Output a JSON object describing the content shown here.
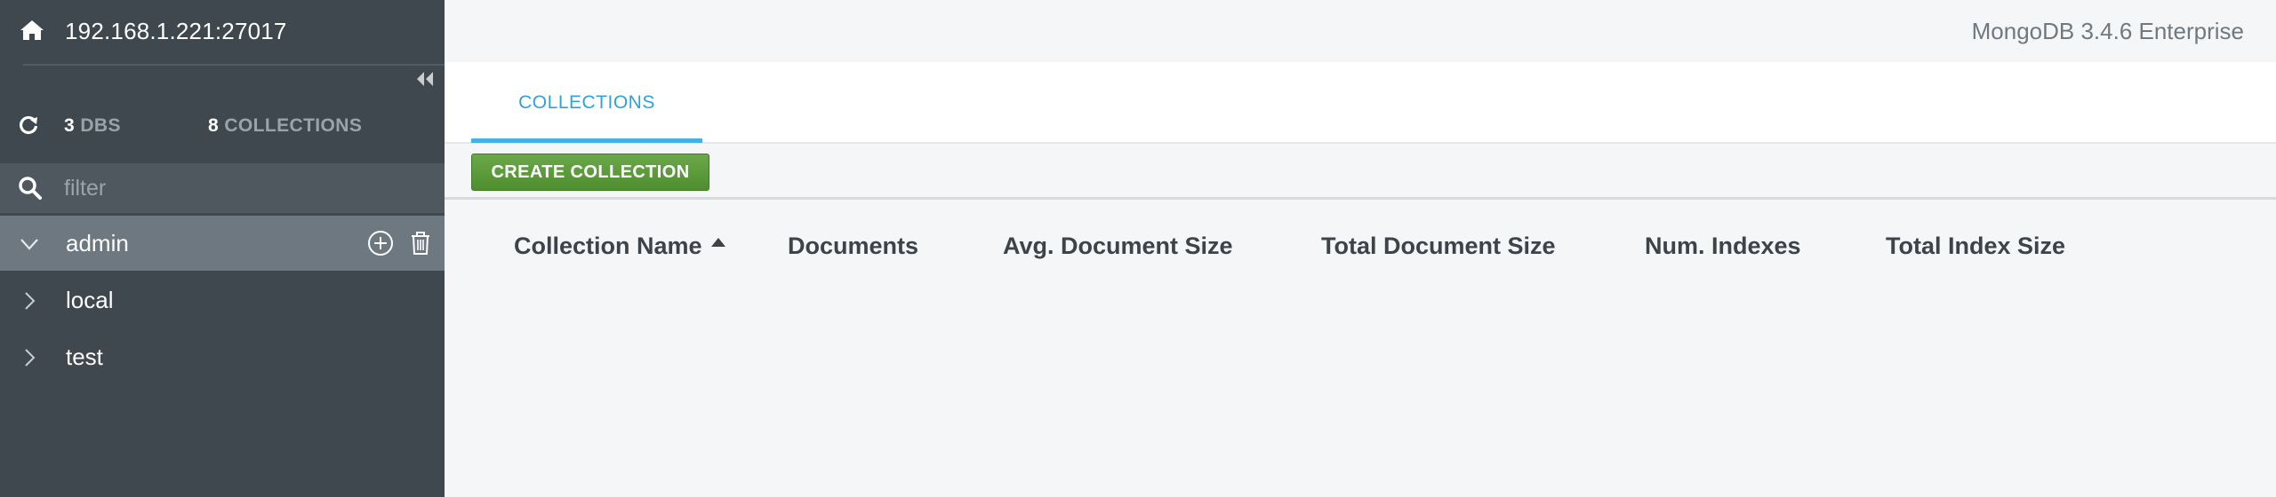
{
  "sidebar": {
    "instance_host": "192.168.1.221:27017",
    "stats": {
      "dbs_count": "3",
      "dbs_label": "DBS",
      "collections_count": "8",
      "collections_label": "COLLECTIONS"
    },
    "filter_placeholder": "filter",
    "databases": [
      {
        "name": "admin",
        "expanded": true
      },
      {
        "name": "local",
        "expanded": false
      },
      {
        "name": "test",
        "expanded": false
      }
    ]
  },
  "header": {
    "version": "MongoDB 3.4.6 Enterprise"
  },
  "tabs": [
    {
      "label": "COLLECTIONS",
      "active": true
    }
  ],
  "toolbar": {
    "create_label": "CREATE COLLECTION"
  },
  "table": {
    "columns": [
      "Collection Name",
      "Documents",
      "Avg. Document Size",
      "Total Document Size",
      "Num. Indexes",
      "Total Index Size"
    ],
    "sort_column": "Collection Name",
    "sort_direction": "ascending",
    "rows": []
  },
  "colors": {
    "sidebar_bg": "#3f484f",
    "active_db_bg": "#6d7880",
    "tab_accent": "#43b1e5",
    "create_button": "#5a9a39"
  },
  "icons": {
    "home": "home-icon",
    "collapse": "double-chevron-left-icon",
    "refresh": "refresh-icon",
    "search": "search-icon",
    "add": "plus-circle-icon",
    "delete": "trash-icon"
  }
}
